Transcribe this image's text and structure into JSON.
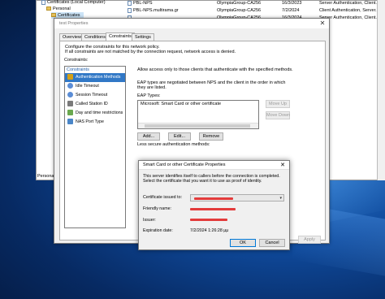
{
  "mmc": {
    "tree_root": "Certificates (Local Computer)",
    "tree_personal": "Personal",
    "tree_certificates": "Certificates",
    "personal_tab": "Personal",
    "rows": [
      {
        "name": "PBL-NPS",
        "issuer": "OlympiaGroup-CA256",
        "date": "16/3/2023",
        "purpose": "Server Authentication, Client..."
      },
      {
        "name": "PBL-NPS.multirama.gr",
        "issuer": "OlympiaGroup-CA256",
        "date": "7/2/2024",
        "purpose": "Client Authentication, Server..."
      },
      {
        "name": "",
        "issuer": "OlympiaGroup-CA256",
        "date": "16/3/2024",
        "purpose": "Server Authentication, Client..."
      }
    ]
  },
  "props": {
    "title": "test Properties",
    "close": "✕",
    "tabs": [
      "Overview",
      "Conditions",
      "Constraints",
      "Settings"
    ],
    "description": "Configure the constraints for this network policy.\nIf all constraints are not matched by the connection request, network access is denied.",
    "constraints_label": "Constraints:",
    "constraints_header": "Constraints",
    "constraints": [
      {
        "label": "Authentication Methods",
        "icon": "lock-icon",
        "color": "#d4a017"
      },
      {
        "label": "Idle Timeout",
        "icon": "clock-icon",
        "color": "#5b8dd6"
      },
      {
        "label": "Session Timeout",
        "icon": "clock-icon",
        "color": "#5b8dd6"
      },
      {
        "label": "Called Station ID",
        "icon": "phone-icon",
        "color": "#7a7a7a"
      },
      {
        "label": "Day and time restrictions",
        "icon": "calendar-icon",
        "color": "#6aa84f"
      },
      {
        "label": "NAS Port Type",
        "icon": "network-icon",
        "color": "#4a86c8"
      }
    ],
    "allow_access_label": "Allow access only to those clients that authenticate with the specified methods.",
    "eap_description": "EAP types are negotiated between NPS and the client in the order in which they are listed.",
    "eap_types_label": "EAP Types:",
    "eap_types": [
      "Microsoft: Smart Card or other certificate"
    ],
    "move_up": "Move Up",
    "move_down": "Move Down",
    "add": "Add...",
    "edit": "Edit...",
    "remove": "Remove",
    "less_secure_label": "Less secure authentication methods:",
    "apply": "Apply"
  },
  "cert": {
    "title": "Smart Card or other Certificate Properties",
    "close": "✕",
    "description": "This server identifies itself to callers before the connection is completed. Select the certificate that you want it to use as proof of identity.",
    "issued_to_label": "Certificate issued to:",
    "friendly_name_label": "Friendly name:",
    "issuer_label": "Issuer:",
    "expiration_label": "Expiration date:",
    "expiration_value": "7/2/2024 1:26:28 μμ",
    "ok": "OK",
    "cancel": "Cancel",
    "redaction_color": "#e33b3b"
  }
}
